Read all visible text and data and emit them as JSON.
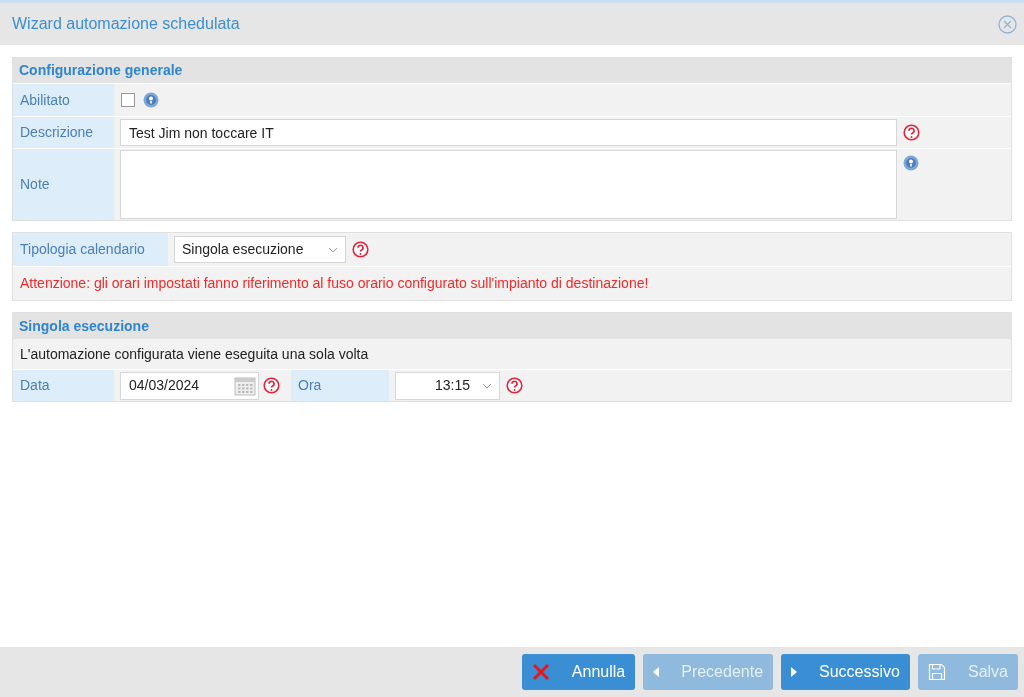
{
  "window": {
    "title": "Wizard automazione schedulata"
  },
  "general": {
    "title": "Configurazione generale",
    "enabled": {
      "label": "Abilitato",
      "checked": false
    },
    "description": {
      "label": "Descrizione",
      "value": "Test Jim non toccare IT"
    },
    "notes": {
      "label": "Note"
    }
  },
  "calendar": {
    "label": "Tipologia calendario",
    "value": "Singola esecuzione",
    "warning": "Attenzione: gli orari impostati fanno riferimento al fuso orario configurato sull'impianto di destinazione!"
  },
  "single": {
    "title": "Singola esecuzione",
    "text": "L'automazione configurata viene eseguita una sola volta",
    "date": {
      "label": "Data",
      "value": "04/03/2024"
    },
    "time": {
      "label": "Ora",
      "value": "13:15"
    }
  },
  "buttons": [
    {
      "kind": "cancel",
      "label": "Annulla",
      "disabled": false
    },
    {
      "kind": "previous",
      "label": "Precedente",
      "disabled": true
    },
    {
      "kind": "next",
      "label": "Successivo",
      "disabled": false
    },
    {
      "kind": "save",
      "label": "Salva",
      "disabled": true
    }
  ]
}
